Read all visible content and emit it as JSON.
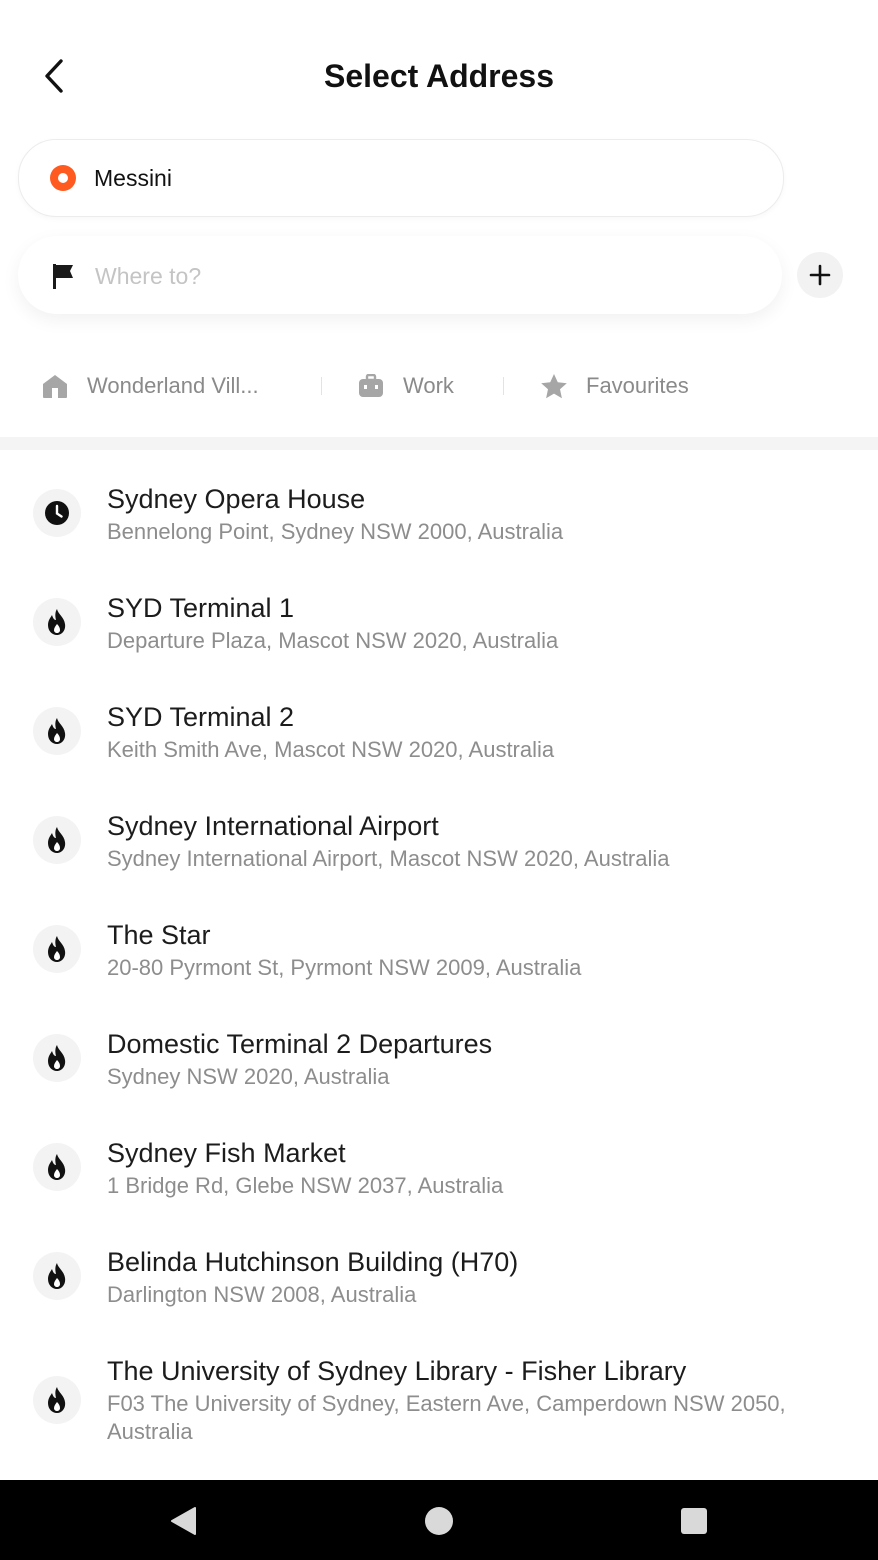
{
  "header": {
    "title": "Select Address"
  },
  "pickup": {
    "value": "Messini"
  },
  "destination": {
    "placeholder": "Where to?",
    "value": ""
  },
  "shortcuts": [
    {
      "label": "Wonderland Vill...",
      "icon": "home-icon"
    },
    {
      "label": "Work",
      "icon": "briefcase-icon"
    },
    {
      "label": "Favourites",
      "icon": "star-icon"
    }
  ],
  "places": [
    {
      "name": "Sydney Opera House",
      "address": "Bennelong Point, Sydney NSW 2000, Australia",
      "icon": "clock-icon"
    },
    {
      "name": "SYD Terminal 1",
      "address": "Departure Plaza, Mascot NSW 2020, Australia",
      "icon": "flame-icon"
    },
    {
      "name": "SYD Terminal 2",
      "address": "Keith Smith Ave, Mascot NSW 2020, Australia",
      "icon": "flame-icon"
    },
    {
      "name": "Sydney International Airport",
      "address": "Sydney International Airport, Mascot NSW 2020, Australia",
      "icon": "flame-icon"
    },
    {
      "name": "The Star",
      "address": "20-80 Pyrmont St, Pyrmont NSW 2009, Australia",
      "icon": "flame-icon"
    },
    {
      "name": "Domestic Terminal 2 Departures",
      "address": "Sydney NSW 2020, Australia",
      "icon": "flame-icon"
    },
    {
      "name": "Sydney Fish Market",
      "address": "1 Bridge Rd, Glebe NSW 2037, Australia",
      "icon": "flame-icon"
    },
    {
      "name": "Belinda Hutchinson Building (H70)",
      "address": "Darlington NSW 2008, Australia",
      "icon": "flame-icon"
    },
    {
      "name": "The University of Sydney Library - Fisher Library",
      "address": "F03 The University of Sydney, Eastern Ave, Camperdown NSW 2050, Australia",
      "icon": "flame-icon"
    }
  ],
  "colors": {
    "accent": "#ff5a1f",
    "text_primary": "#1c1c1c",
    "text_secondary": "#8d8d8d",
    "navbar": "#000000"
  }
}
